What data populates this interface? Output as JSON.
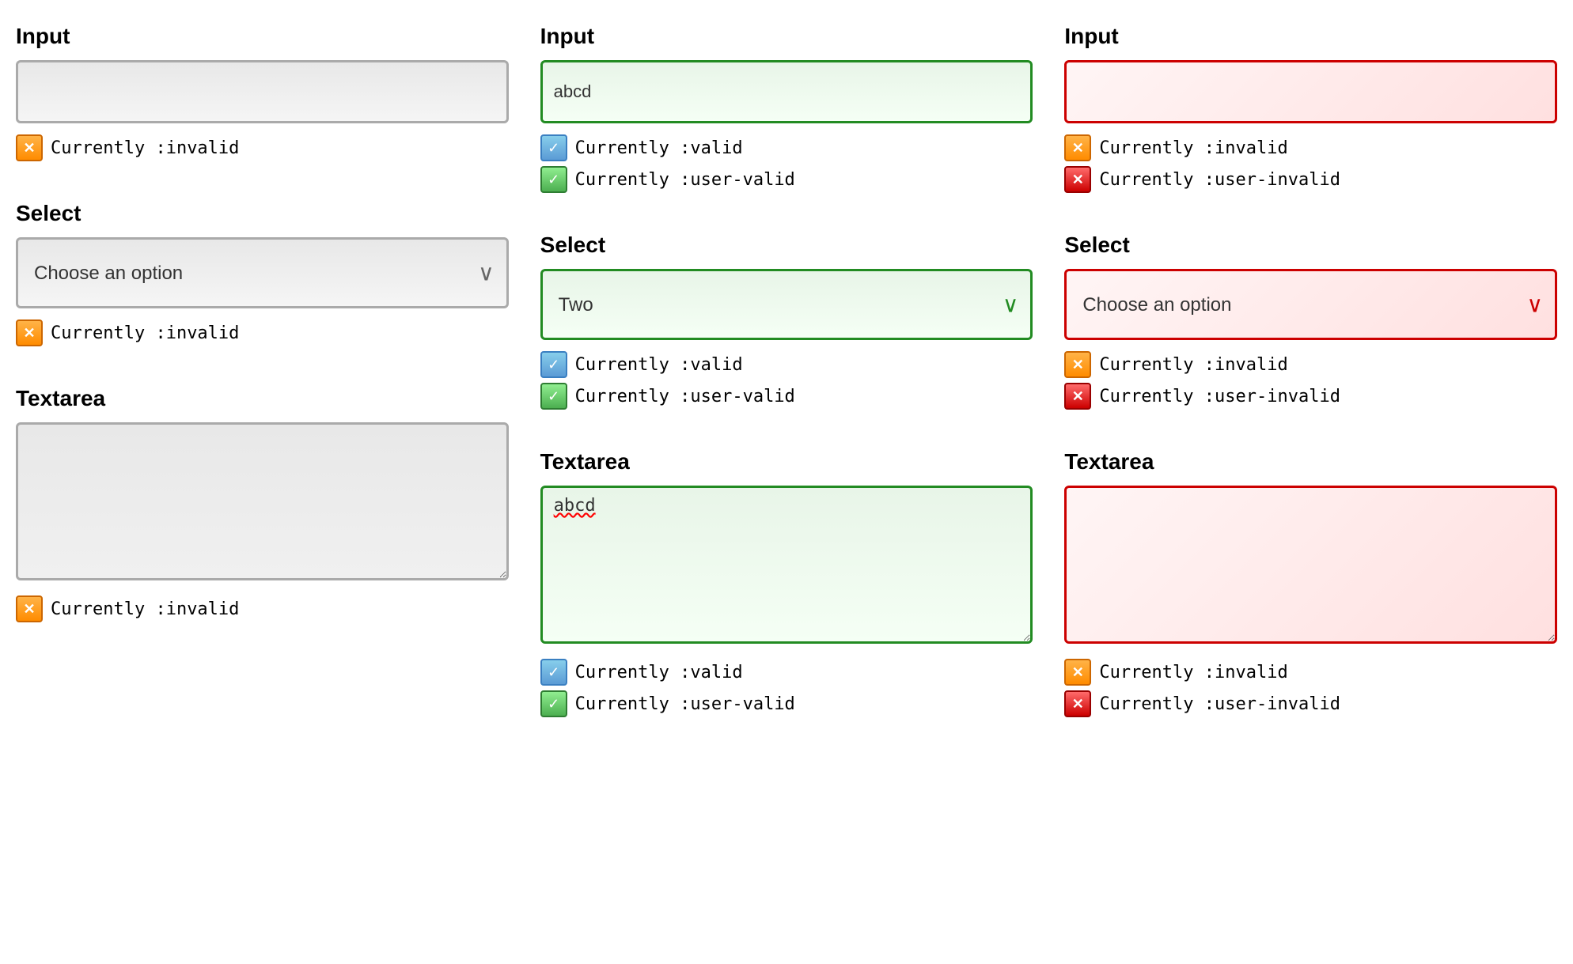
{
  "columns": [
    {
      "id": "neutral",
      "sections": [
        {
          "type": "input",
          "label": "Input",
          "value": "",
          "placeholder": "",
          "style": "neutral",
          "statuses": [
            {
              "iconType": "orange-x",
              "text": "Currently :invalid"
            }
          ]
        },
        {
          "type": "select",
          "label": "Select",
          "value": "Choose an option",
          "style": "neutral",
          "chevronClass": "chevron-neutral",
          "statuses": [
            {
              "iconType": "orange-x",
              "text": "Currently :invalid"
            }
          ]
        },
        {
          "type": "textarea",
          "label": "Textarea",
          "value": "",
          "style": "neutral",
          "statuses": [
            {
              "iconType": "orange-x",
              "text": "Currently :invalid"
            }
          ]
        }
      ]
    },
    {
      "id": "valid",
      "sections": [
        {
          "type": "input",
          "label": "Input",
          "value": "abcd",
          "style": "valid",
          "statuses": [
            {
              "iconType": "blue-check",
              "text": "Currently :valid"
            },
            {
              "iconType": "green-check",
              "text": "Currently :user-valid"
            }
          ]
        },
        {
          "type": "select",
          "label": "Select",
          "value": "Two",
          "style": "valid",
          "chevronClass": "chevron-valid",
          "statuses": [
            {
              "iconType": "blue-check",
              "text": "Currently :valid"
            },
            {
              "iconType": "green-check",
              "text": "Currently :user-valid"
            }
          ]
        },
        {
          "type": "textarea",
          "label": "Textarea",
          "value": "abcd",
          "style": "valid",
          "statuses": [
            {
              "iconType": "blue-check",
              "text": "Currently :valid"
            },
            {
              "iconType": "green-check",
              "text": "Currently :user-valid"
            }
          ]
        }
      ]
    },
    {
      "id": "invalid",
      "sections": [
        {
          "type": "input",
          "label": "Input",
          "value": "",
          "style": "invalid",
          "statuses": [
            {
              "iconType": "orange-x",
              "text": "Currently :invalid"
            },
            {
              "iconType": "red-x",
              "text": "Currently :user-invalid"
            }
          ]
        },
        {
          "type": "select",
          "label": "Select",
          "value": "Choose an option",
          "style": "invalid",
          "chevronClass": "chevron-invalid",
          "statuses": [
            {
              "iconType": "orange-x",
              "text": "Currently :invalid"
            },
            {
              "iconType": "red-x",
              "text": "Currently :user-invalid"
            }
          ]
        },
        {
          "type": "textarea",
          "label": "Textarea",
          "value": "",
          "style": "invalid",
          "statuses": [
            {
              "iconType": "orange-x",
              "text": "Currently :invalid"
            },
            {
              "iconType": "red-x",
              "text": "Currently :user-invalid"
            }
          ]
        }
      ]
    }
  ],
  "icons": {
    "orange-x": "✕",
    "blue-check": "✓",
    "green-check": "✓",
    "red-x": "✕"
  },
  "chevron": "∨"
}
